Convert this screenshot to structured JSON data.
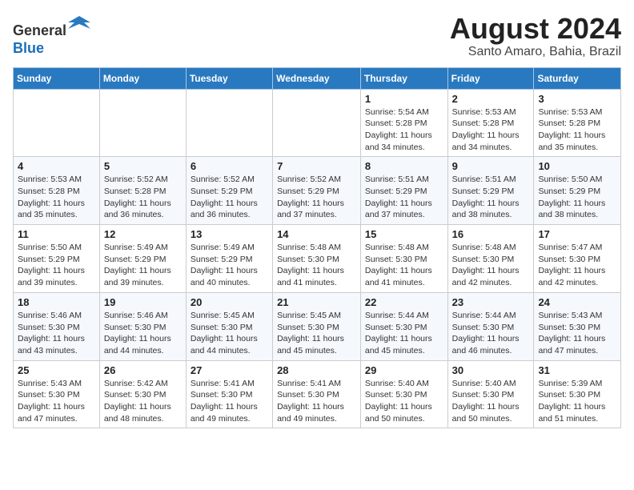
{
  "header": {
    "logo_line1": "General",
    "logo_line2": "Blue",
    "title": "August 2024",
    "subtitle": "Santo Amaro, Bahia, Brazil"
  },
  "weekdays": [
    "Sunday",
    "Monday",
    "Tuesday",
    "Wednesday",
    "Thursday",
    "Friday",
    "Saturday"
  ],
  "weeks": [
    [
      {
        "day": "",
        "info": ""
      },
      {
        "day": "",
        "info": ""
      },
      {
        "day": "",
        "info": ""
      },
      {
        "day": "",
        "info": ""
      },
      {
        "day": "1",
        "info": "Sunrise: 5:54 AM\nSunset: 5:28 PM\nDaylight: 11 hours\nand 34 minutes."
      },
      {
        "day": "2",
        "info": "Sunrise: 5:53 AM\nSunset: 5:28 PM\nDaylight: 11 hours\nand 34 minutes."
      },
      {
        "day": "3",
        "info": "Sunrise: 5:53 AM\nSunset: 5:28 PM\nDaylight: 11 hours\nand 35 minutes."
      }
    ],
    [
      {
        "day": "4",
        "info": "Sunrise: 5:53 AM\nSunset: 5:28 PM\nDaylight: 11 hours\nand 35 minutes."
      },
      {
        "day": "5",
        "info": "Sunrise: 5:52 AM\nSunset: 5:28 PM\nDaylight: 11 hours\nand 36 minutes."
      },
      {
        "day": "6",
        "info": "Sunrise: 5:52 AM\nSunset: 5:29 PM\nDaylight: 11 hours\nand 36 minutes."
      },
      {
        "day": "7",
        "info": "Sunrise: 5:52 AM\nSunset: 5:29 PM\nDaylight: 11 hours\nand 37 minutes."
      },
      {
        "day": "8",
        "info": "Sunrise: 5:51 AM\nSunset: 5:29 PM\nDaylight: 11 hours\nand 37 minutes."
      },
      {
        "day": "9",
        "info": "Sunrise: 5:51 AM\nSunset: 5:29 PM\nDaylight: 11 hours\nand 38 minutes."
      },
      {
        "day": "10",
        "info": "Sunrise: 5:50 AM\nSunset: 5:29 PM\nDaylight: 11 hours\nand 38 minutes."
      }
    ],
    [
      {
        "day": "11",
        "info": "Sunrise: 5:50 AM\nSunset: 5:29 PM\nDaylight: 11 hours\nand 39 minutes."
      },
      {
        "day": "12",
        "info": "Sunrise: 5:49 AM\nSunset: 5:29 PM\nDaylight: 11 hours\nand 39 minutes."
      },
      {
        "day": "13",
        "info": "Sunrise: 5:49 AM\nSunset: 5:29 PM\nDaylight: 11 hours\nand 40 minutes."
      },
      {
        "day": "14",
        "info": "Sunrise: 5:48 AM\nSunset: 5:30 PM\nDaylight: 11 hours\nand 41 minutes."
      },
      {
        "day": "15",
        "info": "Sunrise: 5:48 AM\nSunset: 5:30 PM\nDaylight: 11 hours\nand 41 minutes."
      },
      {
        "day": "16",
        "info": "Sunrise: 5:48 AM\nSunset: 5:30 PM\nDaylight: 11 hours\nand 42 minutes."
      },
      {
        "day": "17",
        "info": "Sunrise: 5:47 AM\nSunset: 5:30 PM\nDaylight: 11 hours\nand 42 minutes."
      }
    ],
    [
      {
        "day": "18",
        "info": "Sunrise: 5:46 AM\nSunset: 5:30 PM\nDaylight: 11 hours\nand 43 minutes."
      },
      {
        "day": "19",
        "info": "Sunrise: 5:46 AM\nSunset: 5:30 PM\nDaylight: 11 hours\nand 44 minutes."
      },
      {
        "day": "20",
        "info": "Sunrise: 5:45 AM\nSunset: 5:30 PM\nDaylight: 11 hours\nand 44 minutes."
      },
      {
        "day": "21",
        "info": "Sunrise: 5:45 AM\nSunset: 5:30 PM\nDaylight: 11 hours\nand 45 minutes."
      },
      {
        "day": "22",
        "info": "Sunrise: 5:44 AM\nSunset: 5:30 PM\nDaylight: 11 hours\nand 45 minutes."
      },
      {
        "day": "23",
        "info": "Sunrise: 5:44 AM\nSunset: 5:30 PM\nDaylight: 11 hours\nand 46 minutes."
      },
      {
        "day": "24",
        "info": "Sunrise: 5:43 AM\nSunset: 5:30 PM\nDaylight: 11 hours\nand 47 minutes."
      }
    ],
    [
      {
        "day": "25",
        "info": "Sunrise: 5:43 AM\nSunset: 5:30 PM\nDaylight: 11 hours\nand 47 minutes."
      },
      {
        "day": "26",
        "info": "Sunrise: 5:42 AM\nSunset: 5:30 PM\nDaylight: 11 hours\nand 48 minutes."
      },
      {
        "day": "27",
        "info": "Sunrise: 5:41 AM\nSunset: 5:30 PM\nDaylight: 11 hours\nand 49 minutes."
      },
      {
        "day": "28",
        "info": "Sunrise: 5:41 AM\nSunset: 5:30 PM\nDaylight: 11 hours\nand 49 minutes."
      },
      {
        "day": "29",
        "info": "Sunrise: 5:40 AM\nSunset: 5:30 PM\nDaylight: 11 hours\nand 50 minutes."
      },
      {
        "day": "30",
        "info": "Sunrise: 5:40 AM\nSunset: 5:30 PM\nDaylight: 11 hours\nand 50 minutes."
      },
      {
        "day": "31",
        "info": "Sunrise: 5:39 AM\nSunset: 5:30 PM\nDaylight: 11 hours\nand 51 minutes."
      }
    ]
  ]
}
